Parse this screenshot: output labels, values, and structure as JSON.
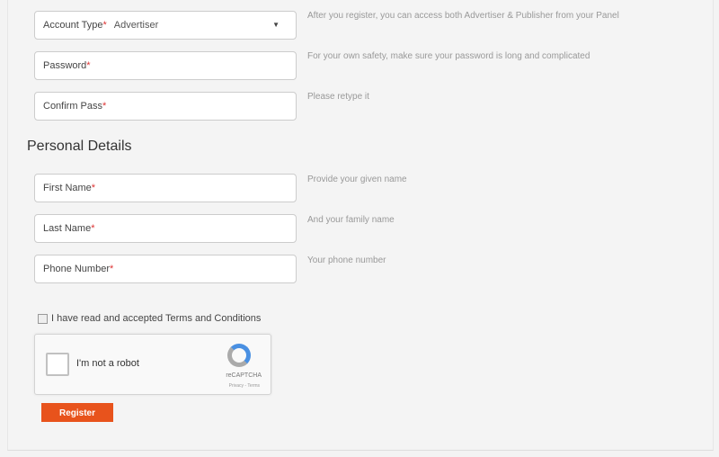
{
  "account": {
    "fields": [
      {
        "label": "Account Type",
        "value": "Advertiser",
        "hint": "After you register, you can access both Advertiser & Publisher from your Panel"
      },
      {
        "label": "Password",
        "hint": "For your own safety, make sure your password is long and complicated"
      },
      {
        "label": "Confirm Pass",
        "hint": "Please retype it"
      }
    ]
  },
  "personal": {
    "title": "Personal Details",
    "fields": [
      {
        "label": "First Name",
        "hint": "Provide your given name"
      },
      {
        "label": "Last Name",
        "hint": "And your family name"
      },
      {
        "label": "Phone Number",
        "hint": "Your phone number"
      }
    ]
  },
  "required_mark": "*",
  "caret": "▼",
  "terms": "I have read and accepted Terms and Conditions",
  "captcha": {
    "label": "I'm not a robot",
    "brand": "reCAPTCHA",
    "links": "Privacy - Terms"
  },
  "register_label": "Register"
}
